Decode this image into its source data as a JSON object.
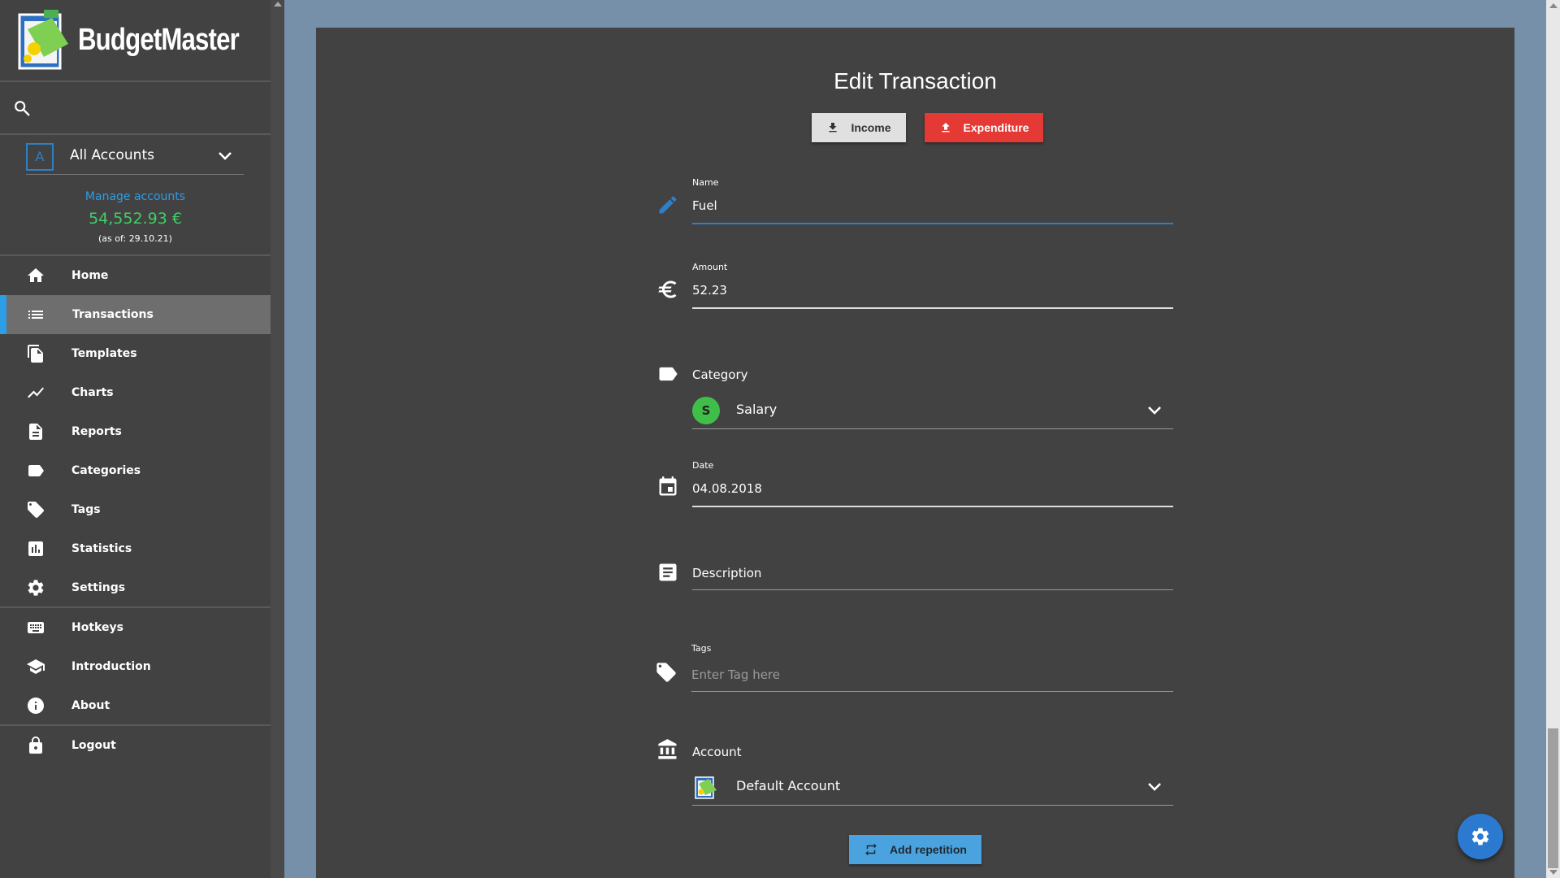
{
  "app": {
    "brand": "BudgetMaster"
  },
  "account_selector": {
    "badge": "A",
    "selected": "All Accounts",
    "manage_label": "Manage accounts",
    "balance": "54,552.93 €",
    "as_of": "(as of: 29.10.21)"
  },
  "nav": {
    "home": "Home",
    "transactions": "Transactions",
    "templates": "Templates",
    "charts": "Charts",
    "reports": "Reports",
    "categories": "Categories",
    "tags": "Tags",
    "statistics": "Statistics",
    "settings": "Settings",
    "hotkeys": "Hotkeys",
    "introduction": "Introduction",
    "about": "About",
    "logout": "Logout"
  },
  "form": {
    "title": "Edit Transaction",
    "income_label": "Income",
    "expenditure_label": "Expenditure",
    "name_label": "Name",
    "name_value": "Fuel",
    "amount_label": "Amount",
    "amount_value": "52.23",
    "category_label": "Category",
    "category_badge": "S",
    "category_value": "Salary",
    "date_label": "Date",
    "date_value": "04.08.2018",
    "description_label": "Description",
    "tags_label": "Tags",
    "tags_placeholder": "Enter Tag here",
    "account_label": "Account",
    "account_value": "Default Account",
    "add_repetition_label": "Add repetition"
  },
  "colors": {
    "accent_blue": "#2d9de6",
    "expenditure_red": "#e53935",
    "balance_green": "#3fcf66",
    "category_salary": "#3fbf4a"
  }
}
